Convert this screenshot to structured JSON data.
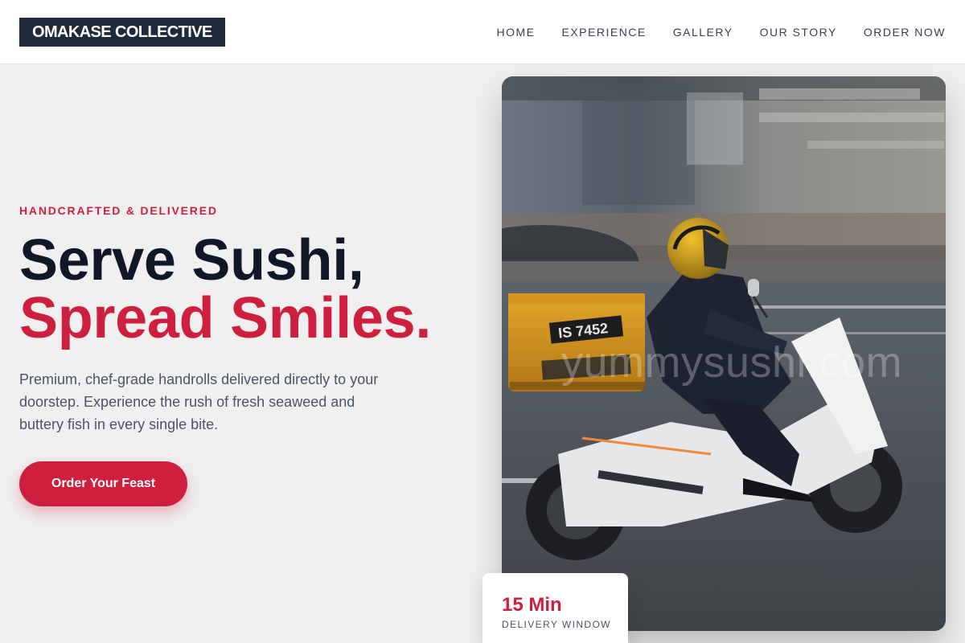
{
  "header": {
    "logo": "OMAKASE COLLECTIVE",
    "nav": [
      "HOME",
      "EXPERIENCE",
      "GALLERY",
      "OUR STORY",
      "ORDER NOW"
    ]
  },
  "hero": {
    "eyebrow": "HANDCRAFTED & DELIVERED",
    "headline_line1": "Serve Sushi,",
    "headline_line2": "Spread Smiles.",
    "description": "Premium, chef-grade handrolls delivered directly to your doorstep. Experience the rush of fresh seaweed and buttery fish in every single bite.",
    "cta_label": "Order Your Feast"
  },
  "photo": {
    "watermark": "yummysushi.com",
    "plate_text": "IS 7452"
  },
  "badge": {
    "value": "15 Min",
    "label": "DELIVERY WINDOW"
  },
  "colors": {
    "accent": "#cf1f3f",
    "dark": "#101828",
    "logo_bg": "#1e293b",
    "page_bg": "#f0f0f0"
  }
}
